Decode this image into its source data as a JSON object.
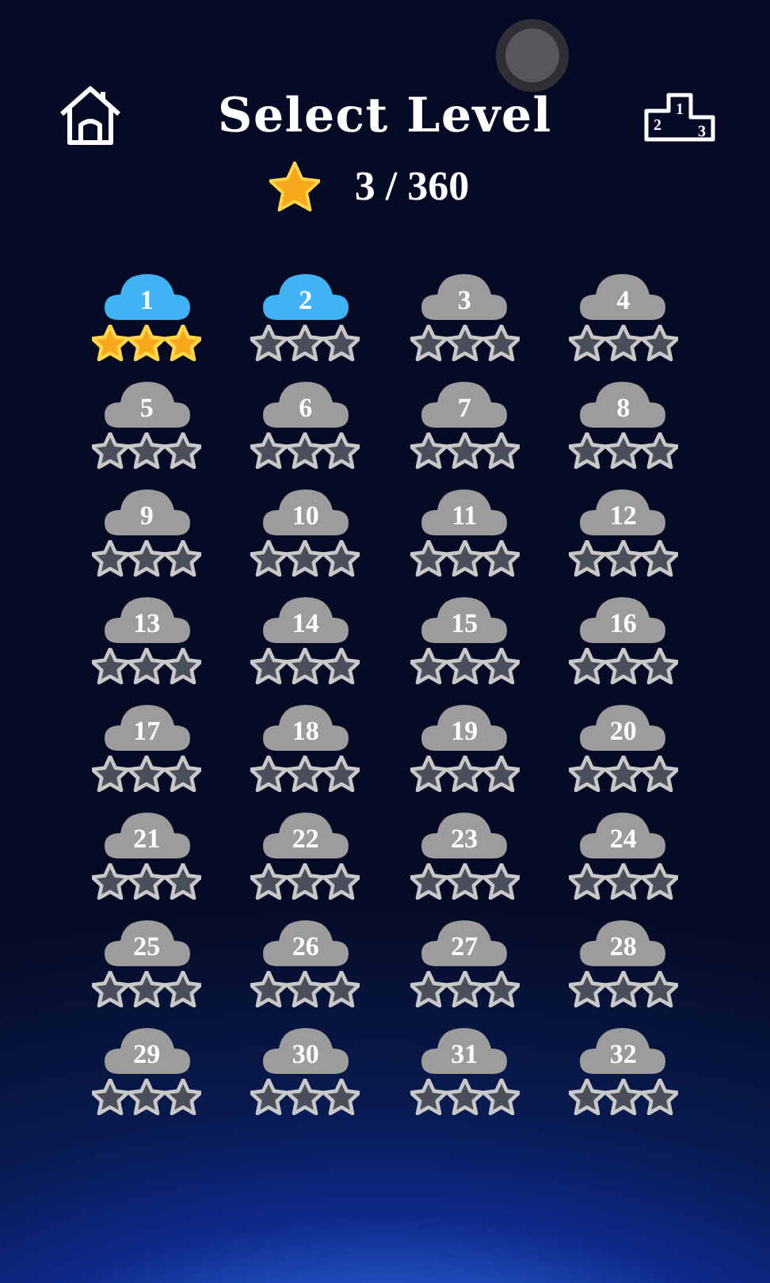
{
  "header": {
    "title": "Select Level",
    "podium_places": [
      "2",
      "1",
      "3"
    ]
  },
  "progress": {
    "count": "3 / 360"
  },
  "levels": [
    {
      "number": "1",
      "unlocked": true,
      "stars": 3
    },
    {
      "number": "2",
      "unlocked": true,
      "stars": 0
    },
    {
      "number": "3",
      "unlocked": false,
      "stars": 0
    },
    {
      "number": "4",
      "unlocked": false,
      "stars": 0
    },
    {
      "number": "5",
      "unlocked": false,
      "stars": 0
    },
    {
      "number": "6",
      "unlocked": false,
      "stars": 0
    },
    {
      "number": "7",
      "unlocked": false,
      "stars": 0
    },
    {
      "number": "8",
      "unlocked": false,
      "stars": 0
    },
    {
      "number": "9",
      "unlocked": false,
      "stars": 0
    },
    {
      "number": "10",
      "unlocked": false,
      "stars": 0
    },
    {
      "number": "11",
      "unlocked": false,
      "stars": 0
    },
    {
      "number": "12",
      "unlocked": false,
      "stars": 0
    },
    {
      "number": "13",
      "unlocked": false,
      "stars": 0
    },
    {
      "number": "14",
      "unlocked": false,
      "stars": 0
    },
    {
      "number": "15",
      "unlocked": false,
      "stars": 0
    },
    {
      "number": "16",
      "unlocked": false,
      "stars": 0
    },
    {
      "number": "17",
      "unlocked": false,
      "stars": 0
    },
    {
      "number": "18",
      "unlocked": false,
      "stars": 0
    },
    {
      "number": "19",
      "unlocked": false,
      "stars": 0
    },
    {
      "number": "20",
      "unlocked": false,
      "stars": 0
    },
    {
      "number": "21",
      "unlocked": false,
      "stars": 0
    },
    {
      "number": "22",
      "unlocked": false,
      "stars": 0
    },
    {
      "number": "23",
      "unlocked": false,
      "stars": 0
    },
    {
      "number": "24",
      "unlocked": false,
      "stars": 0
    },
    {
      "number": "25",
      "unlocked": false,
      "stars": 0
    },
    {
      "number": "26",
      "unlocked": false,
      "stars": 0
    },
    {
      "number": "27",
      "unlocked": false,
      "stars": 0
    },
    {
      "number": "28",
      "unlocked": false,
      "stars": 0
    },
    {
      "number": "29",
      "unlocked": false,
      "stars": 0
    },
    {
      "number": "30",
      "unlocked": false,
      "stars": 0
    },
    {
      "number": "31",
      "unlocked": false,
      "stars": 0
    },
    {
      "number": "32",
      "unlocked": false,
      "stars": 0
    }
  ]
}
